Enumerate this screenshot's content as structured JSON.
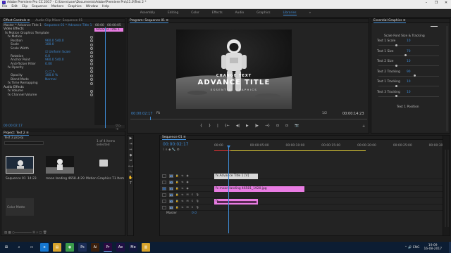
{
  "window": {
    "title": "Adobe Premiere Pro CC 2017 - C:\\Users\\user\\Documents\\Adobe\\Premiere Pro\\11.0\\Test 2 *",
    "controls": [
      "–",
      "❐",
      "✕"
    ]
  },
  "menu": [
    "File",
    "Edit",
    "Clip",
    "Sequence",
    "Markers",
    "Graphics",
    "Window",
    "Help"
  ],
  "workspaces": [
    {
      "label": "Assembly",
      "active": false
    },
    {
      "label": "Editing",
      "active": false
    },
    {
      "label": "Color",
      "active": false
    },
    {
      "label": "Effects",
      "active": false
    },
    {
      "label": "Audio",
      "active": false
    },
    {
      "label": "Graphics",
      "active": false
    },
    {
      "label": "Libraries",
      "active": true
    },
    {
      "label": "»",
      "active": false
    }
  ],
  "effect_controls": {
    "tab": "Effect Controls ≡",
    "tabs_extra": "Audio Clip Mixer: Sequence 01",
    "source": "Master * Advance Title 1",
    "sequence": "Sequence 01 * Advance Title 1",
    "ruler_time": "00:00",
    "ruler_time2": "00:00:05",
    "clip_label": "Advance Title 1",
    "section_video": "Video Effects",
    "rows": [
      {
        "label": "fx  Motion Graphics Template",
        "value": "",
        "indent": 0
      },
      {
        "label": "fx  Motion",
        "value": "",
        "indent": 1
      },
      {
        "label": "Position",
        "value": "960.0      540.0",
        "indent": 2
      },
      {
        "label": "Scale",
        "value": "100.0",
        "indent": 2
      },
      {
        "label": "Scale Width",
        "value": "",
        "indent": 2
      },
      {
        "label": "",
        "value": "☑ Uniform Scale",
        "indent": 2
      },
      {
        "label": "Rotation",
        "value": "0.0",
        "indent": 2
      },
      {
        "label": "Anchor Point",
        "value": "960.0      540.0",
        "indent": 2
      },
      {
        "label": "Anti-flicker Filter",
        "value": "0.00",
        "indent": 2
      },
      {
        "label": "fx  Opacity",
        "value": "",
        "indent": 1
      },
      {
        "label": "",
        "value": "○ □ ✎",
        "indent": 2
      },
      {
        "label": "Opacity",
        "value": "100.0 %",
        "indent": 2
      },
      {
        "label": "Blend Mode",
        "value": "Normal",
        "indent": 2
      },
      {
        "label": "fx  Time Remapping",
        "value": "",
        "indent": 1
      }
    ],
    "section_audio": "Audio Effects",
    "audio_rows": [
      {
        "label": "fx  Volume",
        "indent": 1
      },
      {
        "label": "fx  Channel Volume",
        "indent": 1
      }
    ],
    "timecode": "00:00:02:17"
  },
  "program": {
    "tab": "Program: Sequence 01 ≡",
    "title_small": "CHANGE TEXT",
    "title_big": "ADVANCE TITLE",
    "title_sub": "ESSENTIAL GRAPHICS",
    "timecode_left": "00:00:02:17",
    "fit": "Fit",
    "quality": "1/2",
    "timecode_right": "00:00:14:23",
    "transport": [
      "{",
      "}",
      "|",
      "{←",
      "◀|",
      "▶",
      "|▶",
      "→}",
      "⊡",
      "⊡",
      "📷",
      "+"
    ]
  },
  "essential_graphics": {
    "tab": "Essential Graphics ≡",
    "top_label": "Scale Font Size & Tracking",
    "rows": [
      {
        "label": "Text 1 Scale",
        "value": "10"
      },
      {
        "label": "Text 1 Size",
        "value": "70"
      },
      {
        "label": "Text 2 Size",
        "value": "10"
      },
      {
        "label": "Text 2 Tracking",
        "value": "90"
      },
      {
        "label": "Text 1 Tracking",
        "value": "10"
      },
      {
        "label": "Text 3 Tracking",
        "value": "10"
      },
      {
        "label": "Text 1 Position",
        "value": ""
      }
    ]
  },
  "project": {
    "tab": "Project: Test 2 ≡",
    "file": "Test 2.prproj",
    "items_selected": "1 of 4 items selected",
    "search_placeholder": "",
    "items": [
      {
        "name": "Sequence 01",
        "duration": "14:23"
      },
      {
        "name": "moon landing 4658...",
        "duration": "4:29"
      },
      {
        "name": "Motion Graphics T...",
        "duration": "1 Item"
      },
      {
        "name": "Color Matte",
        "duration": ""
      }
    ]
  },
  "timeline": {
    "tab": "Sequence 01 ≡",
    "timecode": "00:00:02:17",
    "ruler": [
      "00:00",
      "00:00:05:00",
      "00:00:10:00",
      "00:00:15:00",
      "00:00:20:00",
      "00:00:25:00",
      "00:00:30:00"
    ],
    "tracks": [
      {
        "name": "V3",
        "type": "video"
      },
      {
        "name": "V2",
        "type": "video"
      },
      {
        "name": "V1",
        "type": "video",
        "active": true
      },
      {
        "name": "A1",
        "type": "audio"
      },
      {
        "name": "A2",
        "type": "audio"
      },
      {
        "name": "A3",
        "type": "audio"
      }
    ],
    "master": "Master",
    "master_value": "0.0",
    "clips": [
      {
        "label": "fx  Advance Title 1 [V]",
        "track": "V2",
        "color": "#d8d8d8"
      },
      {
        "label": "fx  moon landing 46581_1920.jpg",
        "track": "V1",
        "color": "#e97ce3"
      },
      {
        "label": "fx",
        "track": "A1",
        "color": "#e97ce3"
      }
    ],
    "tools": [
      "▶",
      "⇥",
      "⇔",
      "◆",
      "✂",
      "⟷",
      "✎",
      "✋",
      "T"
    ]
  },
  "taskbar": {
    "apps": [
      {
        "name": "start",
        "glyph": "⊞",
        "color": "#0c1d33"
      },
      {
        "name": "search",
        "glyph": "⌕",
        "color": "#0c1d33"
      },
      {
        "name": "task-view",
        "glyph": "▭",
        "color": "#0c1d33"
      },
      {
        "name": "edge",
        "glyph": "e",
        "color": "#1677d0"
      },
      {
        "name": "explorer",
        "glyph": "▤",
        "color": "#d7a32b"
      },
      {
        "name": "chrome",
        "glyph": "◉",
        "color": "#3a9b4a"
      },
      {
        "name": "photoshop",
        "glyph": "Ps",
        "color": "#1b2c55"
      },
      {
        "name": "illustrator",
        "glyph": "Ai",
        "color": "#3a1f0c"
      },
      {
        "name": "premiere",
        "glyph": "Pr",
        "color": "#2a0a40"
      },
      {
        "name": "after-effects",
        "glyph": "Ae",
        "color": "#1f1044"
      },
      {
        "name": "media-encoder",
        "glyph": "Me",
        "color": "#13173e"
      },
      {
        "name": "explorer-2",
        "glyph": "▥",
        "color": "#d7a32b"
      }
    ],
    "tray": "⌃  🔊  ENG",
    "time": "19:09",
    "date": "16-08-2017"
  }
}
